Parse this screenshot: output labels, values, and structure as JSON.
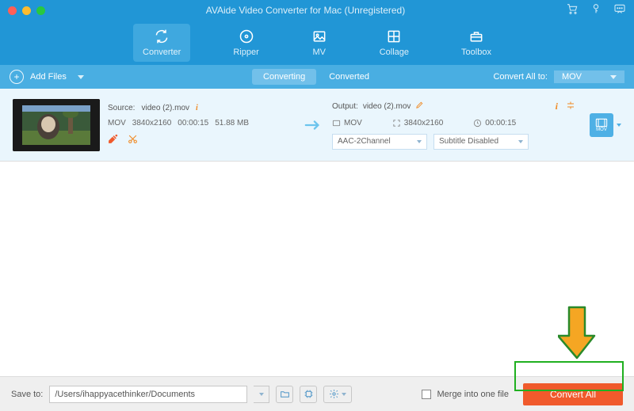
{
  "window": {
    "title": "AVAide Video Converter for Mac (Unregistered)",
    "traffic_colors": [
      "#ff5f57",
      "#febc2e",
      "#28c840"
    ]
  },
  "tabs": [
    "Converter",
    "Ripper",
    "MV",
    "Collage",
    "Toolbox"
  ],
  "toolbar": {
    "add_label": "Add Files",
    "filter_converting": "Converting",
    "filter_converted": "Converted",
    "convert_all_to": "Convert All to:",
    "format": "MOV"
  },
  "item": {
    "source_label": "Source:",
    "source_name": "video (2).mov",
    "codec": "MOV",
    "resolution": "3840x2160",
    "duration": "00:00:15",
    "size": "51.88 MB",
    "output_label": "Output:",
    "output_name": "video (2).mov",
    "out_codec": "MOV",
    "out_res": "3840x2160",
    "out_dur": "00:00:15",
    "audio_sel": "AAC-2Channel",
    "subtitle_sel": "Subtitle Disabled",
    "profile_label": "MOV"
  },
  "footer": {
    "save_to_label": "Save to:",
    "path": "/Users/ihappyacethinker/Documents",
    "merge_label": "Merge into one file",
    "convert_label": "Convert All"
  }
}
